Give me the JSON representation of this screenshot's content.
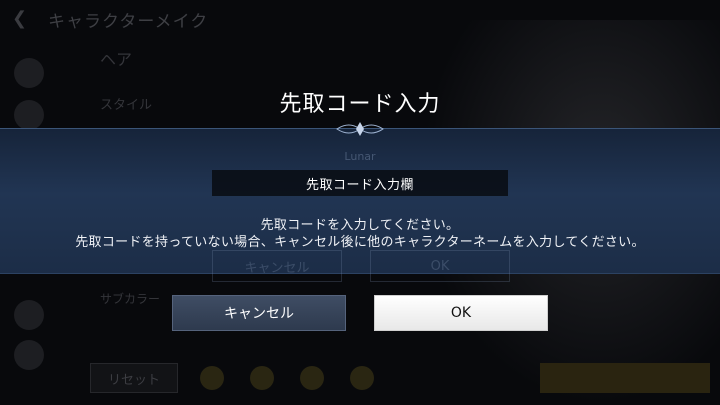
{
  "background": {
    "title": "キャラクターメイク",
    "section": "ヘア",
    "style_label": "スタイル",
    "sub_label": "サブカラー",
    "reset_label": "リセット",
    "field_ghost": "Lunar",
    "cancel_ghost": "キャンセル",
    "ok_ghost": "OK"
  },
  "dialog": {
    "title": "先取コード入力",
    "field_label": "先取コード入力欄",
    "message_line1": "先取コードを入力してください。",
    "message_line2": "先取コードを持っていない場合、キャンセル後に他のキャラクターネームを入力してください。",
    "cancel_label": "キャンセル",
    "ok_label": "OK"
  },
  "colors": {
    "band": "#213553",
    "cancel_button": "#3f4d64",
    "ok_button": "#ffffff"
  }
}
